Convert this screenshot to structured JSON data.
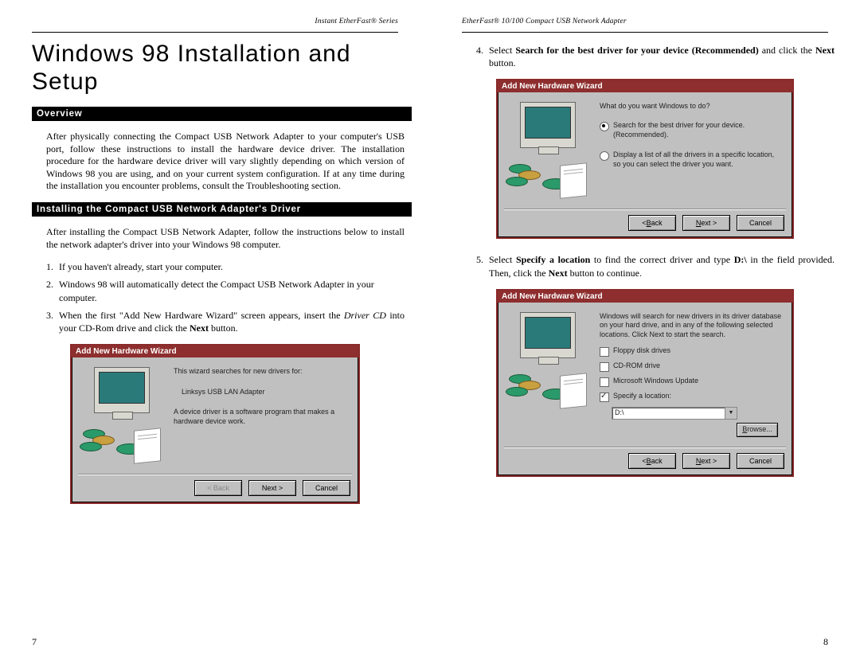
{
  "left_page": {
    "header": "Instant EtherFast® Series",
    "title": "Windows 98 Installation and Setup",
    "section1_title": "Overview",
    "section1_body": "After physically connecting the Compact USB Network Adapter to your computer's USB port, follow these instructions to install the hardware device driver. The installation procedure for the hardware device driver will vary slightly depending on which version of Windows 98 you are using, and on your current system configuration. If at any time during the installation you encounter problems, consult the Troubleshooting section.",
    "section2_title": "Installing the Compact USB Network Adapter's Driver",
    "section2_intro": "After installing the Compact USB Network Adapter, follow the instructions below to install the network adapter's driver into your Windows 98 computer.",
    "step1_num": "1.",
    "step1_body": "If you haven't already, start your computer.",
    "step2_num": "2.",
    "step2_body": "Windows 98 will automatically detect the Compact USB Network Adapter in your computer.",
    "step3_num": "3.",
    "step3_pre": "When the first \"Add New Hardware Wizard\" screen appears, insert the ",
    "step3_italic": "Driver CD",
    "step3_mid": " into your CD-Rom drive and click the ",
    "step3_bold": "Next",
    "step3_post": " button.",
    "dlg1": {
      "title": "Add New Hardware Wizard",
      "line1": "This wizard searches for new drivers for:",
      "device": "Linksys USB LAN Adapter",
      "line2": "A device driver is a software program that makes a hardware device work.",
      "back": "< Back",
      "next": "Next >",
      "cancel": "Cancel"
    },
    "page_num": "7"
  },
  "right_page": {
    "header": "EtherFast® 10/100 Compact USB Network Adapter",
    "step4_num": "4.",
    "step4_pre": "Select ",
    "step4_bold1": "Search for the best driver for your device (Recommended)",
    "step4_mid": " and click the ",
    "step4_bold2": "Next",
    "step4_post": " button.",
    "dlg2": {
      "title": "Add New Hardware Wizard",
      "prompt": "What do you want Windows to do?",
      "opt1": "Search for the best driver for your device. (Recommended).",
      "opt2": "Display a list of all the drivers in a specific location, so you can select the driver you want.",
      "back": "< Back",
      "next": "Next >",
      "cancel": "Cancel"
    },
    "step5_num": "5.",
    "step5_pre": "Select ",
    "step5_bold1": "Specify a location",
    "step5_mid1": " to find the correct driver and type ",
    "step5_bold2": "D:\\",
    "step5_mid2": " in the field provided. Then, click the ",
    "step5_bold3": "Next",
    "step5_post": " button to continue.",
    "dlg3": {
      "title": "Add New Hardware Wizard",
      "intro": "Windows will search for new drivers in its driver database on your hard drive, and in any of the following selected locations. Click Next to start the search.",
      "chk1": "Floppy disk drives",
      "chk2": "CD-ROM drive",
      "chk3": "Microsoft Windows Update",
      "chk4": "Specify a location:",
      "field": "D:\\",
      "browse": "Browse...",
      "back": "< Back",
      "next": "Next >",
      "cancel": "Cancel"
    },
    "page_num": "8"
  }
}
